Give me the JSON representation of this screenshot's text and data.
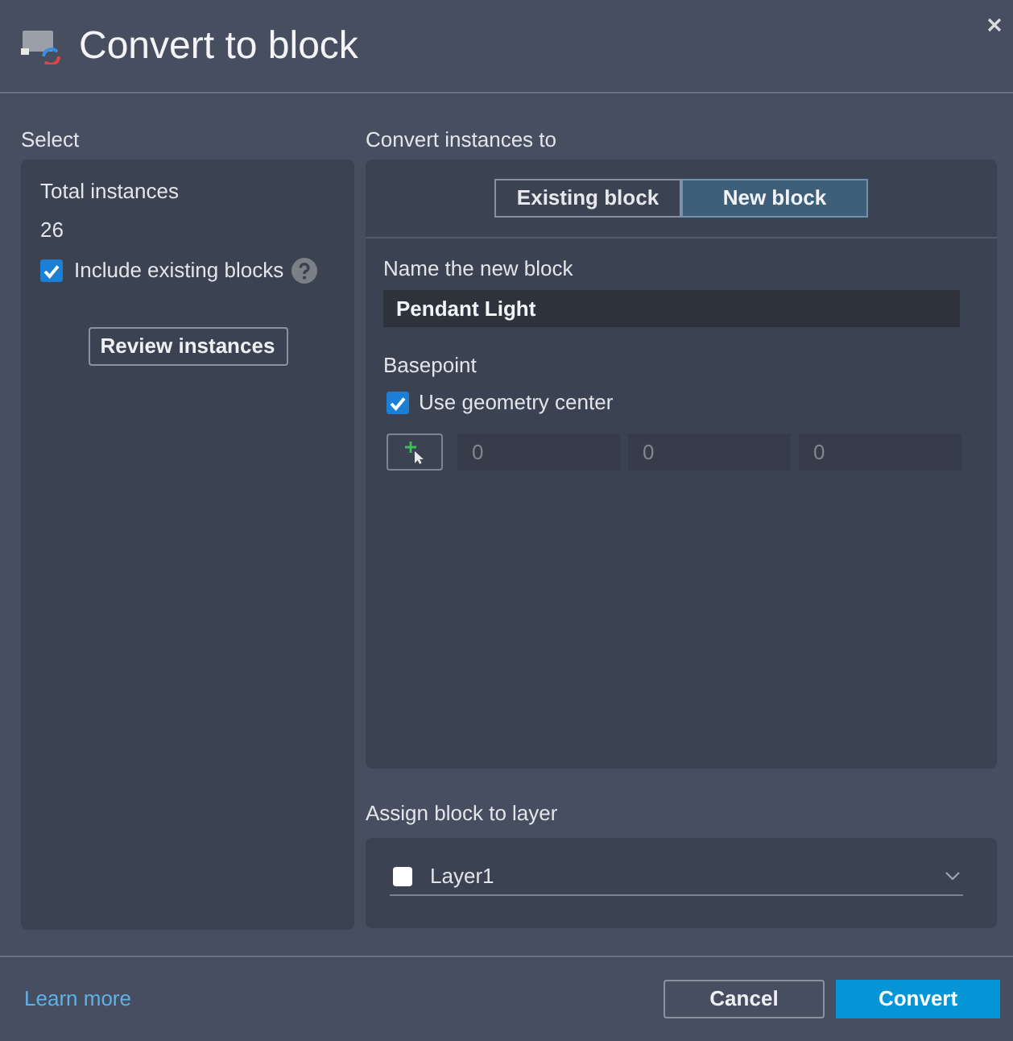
{
  "dialog": {
    "title": "Convert to block"
  },
  "select_section": {
    "label": "Select",
    "total_label": "Total instances",
    "total_value": "26",
    "include_existing": {
      "label": "Include existing blocks",
      "checked": true
    },
    "review_button": "Review instances"
  },
  "convert_section": {
    "label": "Convert instances to",
    "tabs": [
      {
        "label": "Existing block",
        "selected": false
      },
      {
        "label": "New block",
        "selected": true
      }
    ],
    "name_label": "Name the new block",
    "name_value": "Pendant Light",
    "basepoint_label": "Basepoint",
    "use_geometry_center": {
      "label": "Use geometry center",
      "checked": true
    },
    "coordinates": {
      "disabled": true,
      "values": [
        "0",
        "0",
        "0"
      ]
    }
  },
  "layer_section": {
    "label": "Assign block to layer",
    "layer": "Layer1"
  },
  "footer": {
    "link": "Learn more",
    "buttons": [
      {
        "label": "Cancel",
        "kind": "secondary"
      },
      {
        "label": "Convert",
        "kind": "primary"
      }
    ]
  }
}
